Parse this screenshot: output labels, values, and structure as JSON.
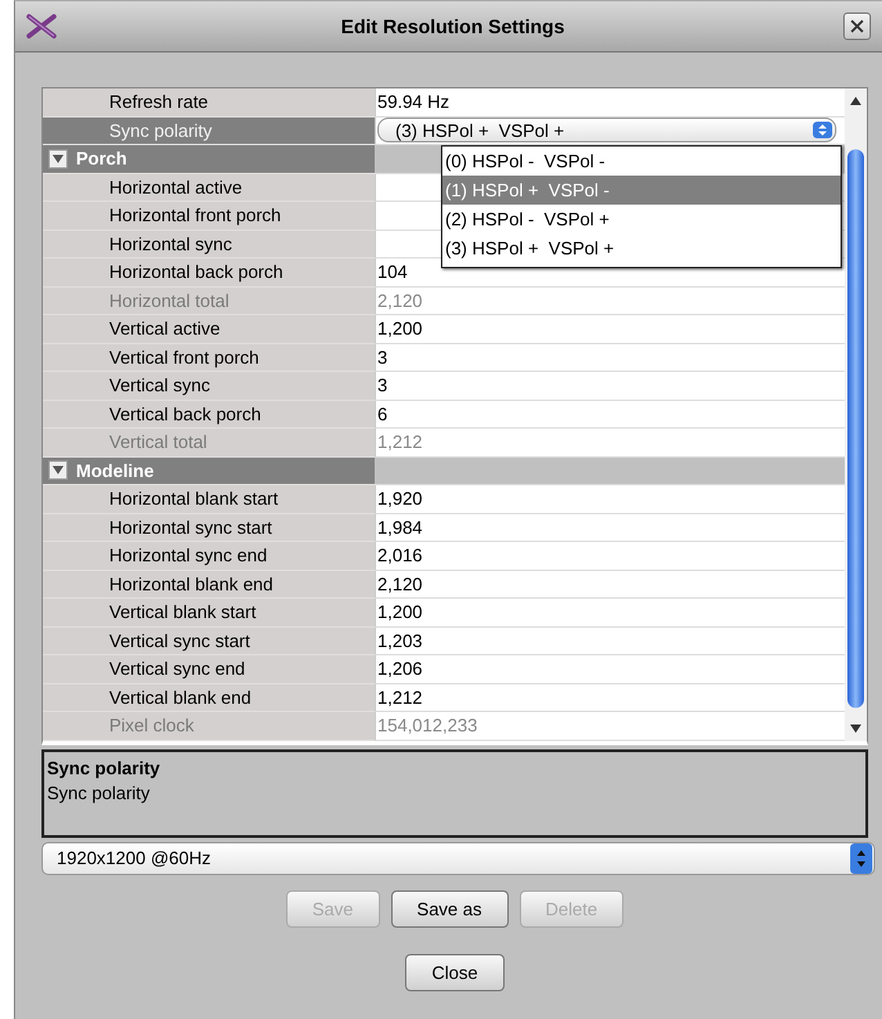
{
  "window": {
    "title": "Edit Resolution Settings"
  },
  "properties": [
    {
      "kind": "property",
      "label": "Refresh rate",
      "value": "59.94 Hz",
      "disabled": false,
      "selected": false
    },
    {
      "kind": "combo",
      "label": "Sync polarity",
      "value": "(3) HSPol +  VSPol +",
      "disabled": false,
      "selected": true
    },
    {
      "kind": "category",
      "label": "Porch",
      "expanded": true
    },
    {
      "kind": "property",
      "label": "Horizontal active",
      "disabled": false,
      "selected": false
    },
    {
      "kind": "property",
      "label": "Horizontal front porch",
      "disabled": false,
      "selected": false
    },
    {
      "kind": "property",
      "label": "Horizontal sync",
      "disabled": false,
      "selected": false
    },
    {
      "kind": "property",
      "label": "Horizontal back porch",
      "value": "104",
      "disabled": false,
      "selected": false
    },
    {
      "kind": "property",
      "label": "Horizontal total",
      "value": "2,120",
      "disabled": true,
      "selected": false
    },
    {
      "kind": "property",
      "label": "Vertical active",
      "value": "1,200",
      "disabled": false,
      "selected": false
    },
    {
      "kind": "property",
      "label": "Vertical front porch",
      "value": "3",
      "disabled": false,
      "selected": false
    },
    {
      "kind": "property",
      "label": "Vertical sync",
      "value": "3",
      "disabled": false,
      "selected": false
    },
    {
      "kind": "property",
      "label": "Vertical back porch",
      "value": "6",
      "disabled": false,
      "selected": false
    },
    {
      "kind": "property",
      "label": "Vertical total",
      "value": "1,212",
      "disabled": true,
      "selected": false
    },
    {
      "kind": "category",
      "label": "Modeline",
      "expanded": true
    },
    {
      "kind": "property",
      "label": "Horizontal blank start",
      "value": "1,920",
      "disabled": false,
      "selected": false
    },
    {
      "kind": "property",
      "label": "Horizontal sync start",
      "value": "1,984",
      "disabled": false,
      "selected": false
    },
    {
      "kind": "property",
      "label": "Horizontal sync end",
      "value": "2,016",
      "disabled": false,
      "selected": false
    },
    {
      "kind": "property",
      "label": "Horizontal blank end",
      "value": "2,120",
      "disabled": false,
      "selected": false
    },
    {
      "kind": "property",
      "label": "Vertical blank start",
      "value": "1,200",
      "disabled": false,
      "selected": false
    },
    {
      "kind": "property",
      "label": "Vertical sync start",
      "value": "1,203",
      "disabled": false,
      "selected": false
    },
    {
      "kind": "property",
      "label": "Vertical sync end",
      "value": "1,206",
      "disabled": false,
      "selected": false
    },
    {
      "kind": "property",
      "label": "Vertical blank end",
      "value": "1,212",
      "disabled": false,
      "selected": false
    },
    {
      "kind": "property",
      "label": "Pixel clock",
      "value": "154,012,233",
      "disabled": true,
      "selected": false
    }
  ],
  "dropdown_options": [
    {
      "label": "(0) HSPol -  VSPol -",
      "selected": false
    },
    {
      "label": "(1) HSPol +  VSPol -",
      "selected": true
    },
    {
      "label": "(2) HSPol -  VSPol +",
      "selected": false
    },
    {
      "label": "(3) HSPol +  VSPol +",
      "selected": false
    }
  ],
  "description": {
    "title": "Sync polarity",
    "text": "Sync polarity"
  },
  "preset_select": {
    "value": "1920x1200 @60Hz"
  },
  "buttons": [
    {
      "label": "Save",
      "disabled": true
    },
    {
      "label": "Save as",
      "disabled": false
    },
    {
      "label": "Delete",
      "disabled": true
    }
  ],
  "close_button": {
    "label": "Close"
  }
}
